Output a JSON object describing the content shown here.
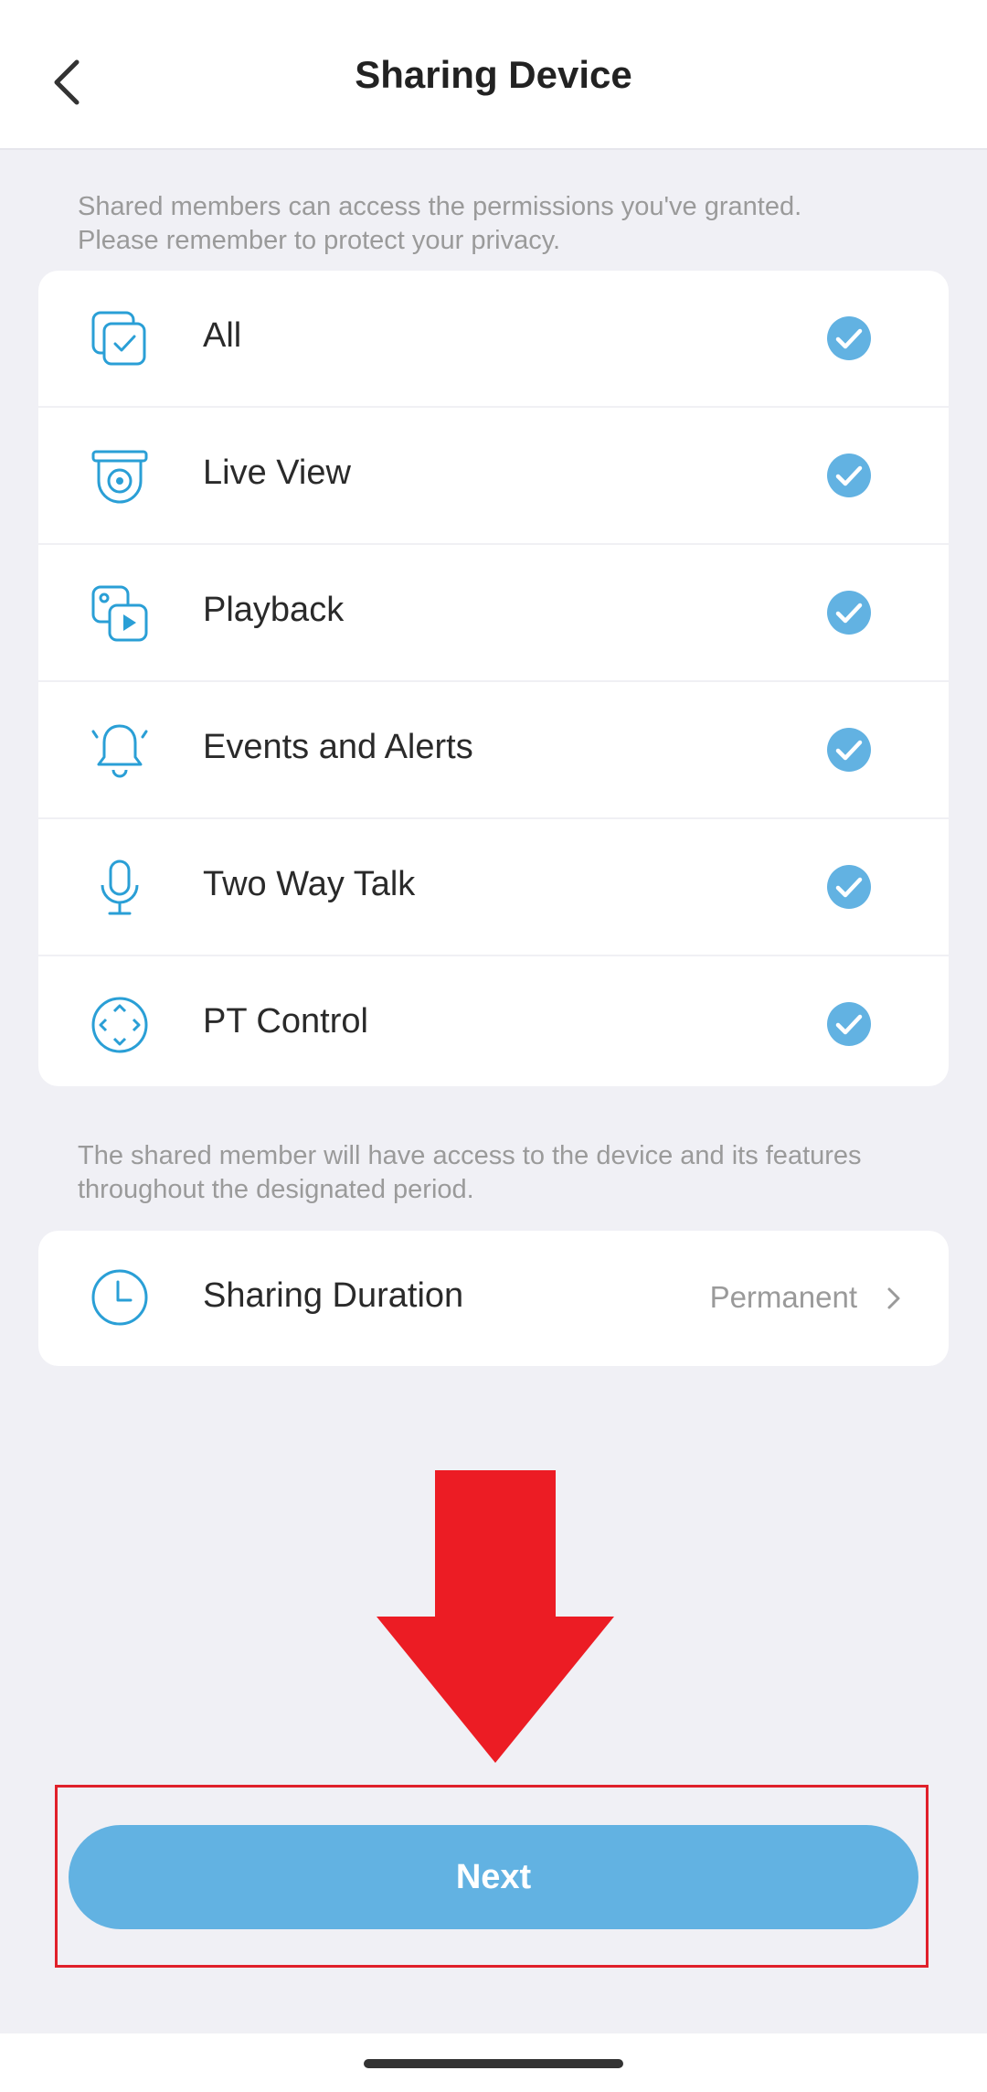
{
  "header": {
    "title": "Sharing Device"
  },
  "permissions_note": {
    "line1": "Shared members can access the permissions you've granted.",
    "line2": "Please remember to protect your privacy."
  },
  "permissions": [
    {
      "label": "All",
      "icon": "select-all-icon",
      "checked": true
    },
    {
      "label": "Live View",
      "icon": "camera-icon",
      "checked": true
    },
    {
      "label": "Playback",
      "icon": "playback-icon",
      "checked": true
    },
    {
      "label": "Events and Alerts",
      "icon": "bell-icon",
      "checked": true
    },
    {
      "label": "Two Way Talk",
      "icon": "microphone-icon",
      "checked": true
    },
    {
      "label": "PT Control",
      "icon": "pan-tilt-icon",
      "checked": true
    }
  ],
  "duration_note": {
    "line1": "The shared member will have access to the device and its features",
    "line2": "throughout the designated period."
  },
  "duration": {
    "label": "Sharing Duration",
    "value": "Permanent"
  },
  "next_button": {
    "label": "Next"
  },
  "colors": {
    "accent": "#62b2e2",
    "icon": "#2a9fd6",
    "annotation": "#ec1c24"
  }
}
